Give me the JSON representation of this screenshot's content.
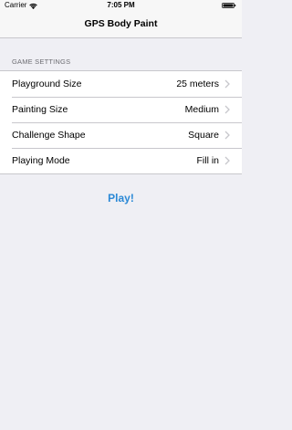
{
  "status_bar": {
    "carrier": "Carrier",
    "time": "7:05 PM",
    "wifi_icon": "wifi-icon",
    "battery_icon": "battery-icon"
  },
  "nav": {
    "title": "GPS Body Paint"
  },
  "settings": {
    "header": "GAME SETTINGS",
    "rows": [
      {
        "label": "Playground Size",
        "value": "25 meters"
      },
      {
        "label": "Painting Size",
        "value": "Medium"
      },
      {
        "label": "Challenge Shape",
        "value": "Square"
      },
      {
        "label": "Playing Mode",
        "value": "Fill in"
      }
    ],
    "chevron_icon": "chevron-right-icon"
  },
  "play_button": {
    "label": "Play!"
  },
  "colors": {
    "accent": "#2b89d6",
    "background": "#efeff4",
    "chevron": "#c7c7cc"
  }
}
